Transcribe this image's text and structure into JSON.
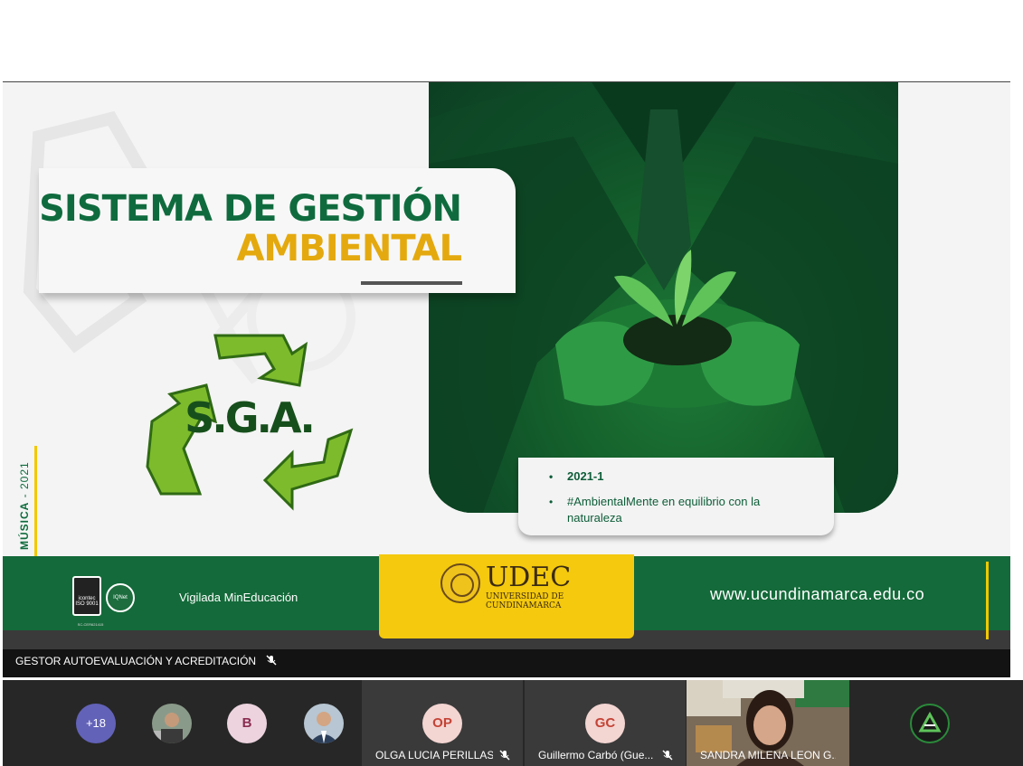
{
  "slide": {
    "title_line1": "SISTEMA DE GESTIÓN",
    "title_line2": "AMBIENTAL",
    "logo_text": "S.G.A.",
    "side_label_bold": "MÚSICA",
    "side_label_rest": " - 2021",
    "info_items": [
      "2021-1",
      "#AmbientalMente en equilibrio con la naturaleza"
    ],
    "footer": {
      "cert_label": "icontec",
      "cert_sub": "ISO 9001",
      "cert_code": "SC-CER621415",
      "iqnet": "IQNet",
      "vigilada": "Vigilada MinEducación",
      "university_name": "UDEC",
      "university_sub": "UNIVERSIDAD DE\nCUNDINAMARCA",
      "website": "www.ucundinamarca.edu.co"
    },
    "colors": {
      "green": "#0f6b3e",
      "yellow": "#e4a90e",
      "footer_green": "#146a3a"
    }
  },
  "caption": {
    "presenter": "GESTOR AUTOEVALUACIÓN Y ACREDITACIÓN",
    "icon": "mic-off-icon"
  },
  "participants": {
    "more_count": "+18",
    "initial_b": "B",
    "tiles": [
      {
        "initials": "OP",
        "name": "OLGA LUCIA PERILLAS...",
        "icon": "mic-off-icon"
      },
      {
        "initials": "GC",
        "name": "Guillermo Carbó (Gue...",
        "icon": "mic-off-icon"
      }
    ],
    "video_name": "SANDRA MILENA LEON G..."
  }
}
